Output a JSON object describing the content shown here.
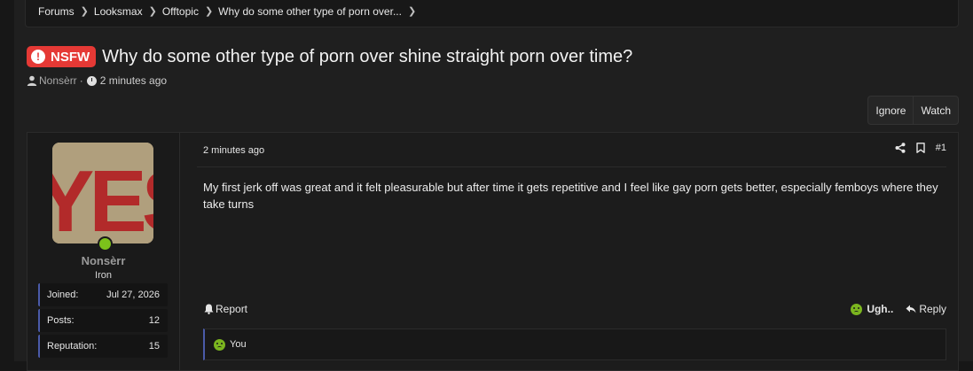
{
  "breadcrumb": {
    "items": [
      "Forums",
      "Looksmax",
      "Offtopic",
      "Why do some other type of porn over..."
    ]
  },
  "thread": {
    "prefix": "NSFW",
    "title": "Why do some other type of porn over shine straight porn over time?",
    "author": "Nonsèrr",
    "time": "2 minutes ago"
  },
  "actions": {
    "ignore": "Ignore",
    "watch": "Watch"
  },
  "post": {
    "date": "2 minutes ago",
    "number": "#1",
    "body": "My first jerk off was great and it felt pleasurable but after time it gets repetitive and I feel like gay porn gets better, especially femboys where they take turns",
    "report": "Report",
    "reaction_label": "Ugh..",
    "reply": "Reply",
    "reacted_by": "You"
  },
  "user": {
    "name": "Nonsèrr",
    "title": "Iron",
    "avatar_text": "YES",
    "stats": [
      {
        "label": "Joined:",
        "value": "Jul 27, 2026"
      },
      {
        "label": "Posts:",
        "value": "12"
      },
      {
        "label": "Reputation:",
        "value": "15"
      }
    ]
  },
  "colors": {
    "nsfw_badge": "#e53935",
    "online": "#7cc21b",
    "stat_accent": "#4a5aa8"
  }
}
